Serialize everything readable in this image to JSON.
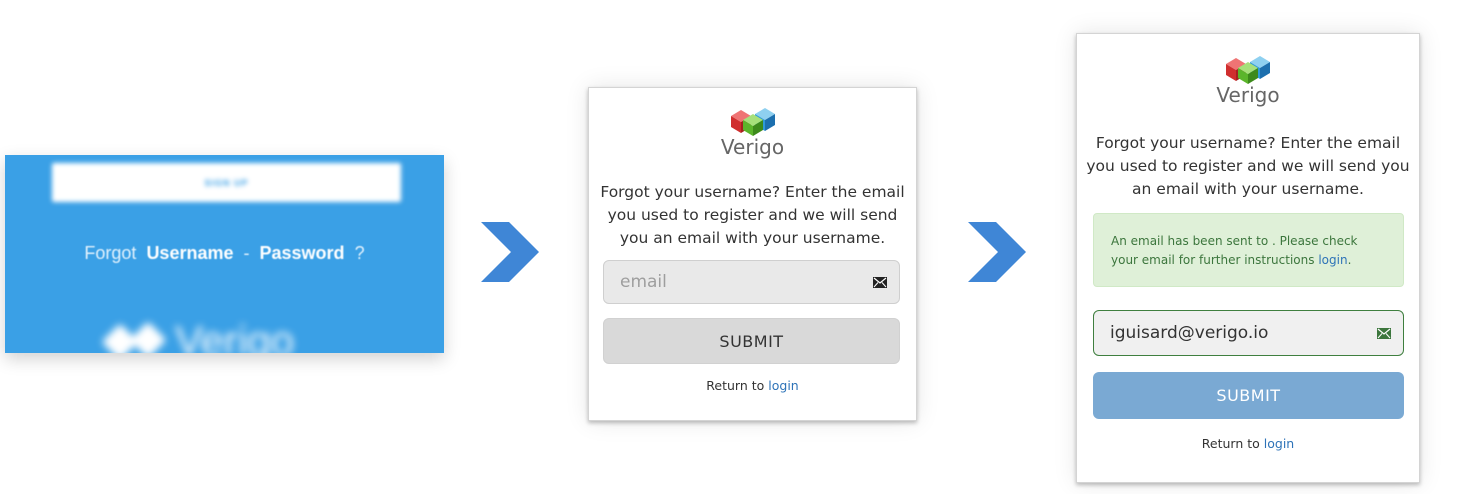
{
  "panel1": {
    "signup_label": "SIGN UP",
    "forgot_prefix": "Forgot",
    "username_link": "Username",
    "separator": "-",
    "password_link": "Password",
    "question": "?",
    "brand": "Verigo"
  },
  "panel2": {
    "brand": "Verigo",
    "description": "Forgot your username? Enter the email you used to register and we will send you an email with your username.",
    "email_placeholder": "email",
    "submit_label": "SUBMIT",
    "return_prefix": "Return to",
    "login_link": "login"
  },
  "panel3": {
    "brand": "Verigo",
    "description": "Forgot your username? Enter the email you used to register and we will send you an email with your username.",
    "alert_text": "An email has been sent to . Please check your email for further instructions",
    "alert_link": "login",
    "alert_end": ".",
    "email_value": "iguisard@verigo.io",
    "submit_label": "SUBMIT",
    "return_prefix": "Return to",
    "login_link": "login"
  },
  "colors": {
    "panel_blue": "#3aa0e6",
    "arrow_blue": "#3f86d6",
    "link_blue": "#2e73b8",
    "alert_green_bg": "#dff0d8",
    "alert_green_text": "#3c763d",
    "submit_active": "#7aa9d3",
    "submit_idle": "#d9d9d9"
  },
  "icons": {
    "email": "envelope-icon",
    "flow": "chevron-right-icon",
    "logo": "verigo-cubes-logo"
  }
}
